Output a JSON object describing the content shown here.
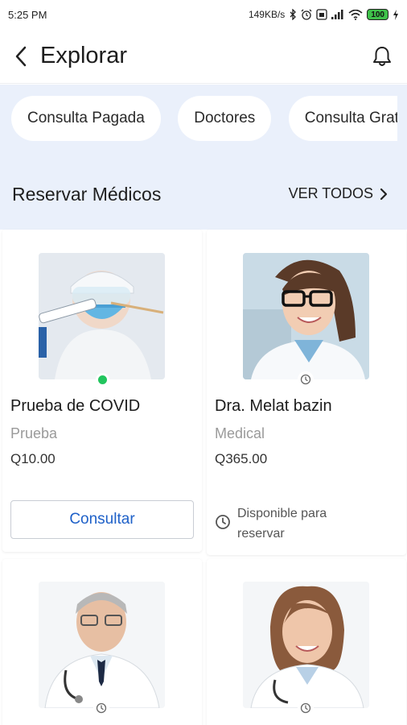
{
  "status_bar": {
    "time": "5:25 PM",
    "network_speed": "149KB/s",
    "battery": "100",
    "icons": [
      "bluetooth-icon",
      "alarm-icon",
      "sim-icon",
      "signal-icon",
      "wifi-icon",
      "battery-icon",
      "charging-icon"
    ]
  },
  "header": {
    "title": "Explorar",
    "back_icon": "chevron-left-icon",
    "notification_icon": "bell-icon"
  },
  "chips": [
    "Consulta Pagada",
    "Doctores",
    "Consulta Gratuita"
  ],
  "section": {
    "title": "Reservar Médicos",
    "see_all": "VER TODOS"
  },
  "cards": [
    {
      "name": "Prueba de COVID",
      "category": "Prueba",
      "price": "Q10.00",
      "button": "Consultar",
      "status": "online"
    },
    {
      "name": "Dra. Melat bazin",
      "category": "Medical",
      "price": "Q365.00",
      "availability": "Disponible para reservar",
      "status": "scheduled"
    },
    {
      "status": "scheduled"
    },
    {
      "status": "scheduled"
    }
  ],
  "colors": {
    "accent": "#1e60c8",
    "hero_bg": "#eaf0fb",
    "online": "#22c55e"
  }
}
